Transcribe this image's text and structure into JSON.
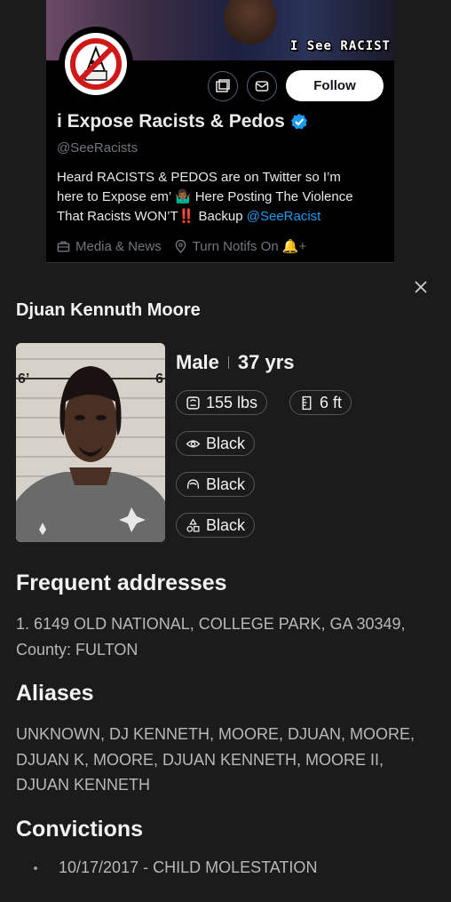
{
  "twitter_card": {
    "banner_text": "I See RACIST",
    "follow_label": "Follow",
    "display_name": "i Expose Racists & Pedos",
    "handle": "@SeeRacists",
    "bio_line_1": "Heard RACISTS & PEDOS are on Twitter so I’m",
    "bio_line_2": "here to Expose em’ 🤷🏾‍♂️ Here Posting The Violence",
    "bio_line_3_prefix": "That Racists WON’T",
    "bio_emphasis": "‼️",
    "bio_line_3_middle": " Backup ",
    "bio_link": "@SeeRacist",
    "meta_category": "Media & News",
    "meta_location": "Turn Notifs On 🔔+"
  },
  "profile": {
    "name": "Djuan Kennuth Moore",
    "gender": "Male",
    "age": "37 yrs",
    "weight": "155 lbs",
    "height": "6 ft",
    "eye_color": "Black",
    "hair_color": "Black",
    "race": "Black",
    "mugshot_marks": {
      "height_left": "6’",
      "height_right": "6"
    }
  },
  "addresses": {
    "title": "Frequent addresses",
    "line_1": "1. 6149 OLD NATIONAL, COLLEGE PARK, GA 30349,",
    "line_2": "County: FULTON"
  },
  "aliases": {
    "title": "Aliases",
    "line_1": "UNKNOWN, DJ KENNETH, MOORE, DJUAN, MOORE,",
    "line_2": "DJUAN K, MOORE, DJUAN KENNETH, MOORE II,",
    "line_3": "DJUAN KENNETH"
  },
  "convictions": {
    "title": "Convictions",
    "items": [
      "10/17/2017 - CHILD MOLESTATION"
    ]
  },
  "colors": {
    "background": "#1b1b1b",
    "twitter_blue": "#1d9bf0",
    "muted_text": "#b8b8b8"
  }
}
